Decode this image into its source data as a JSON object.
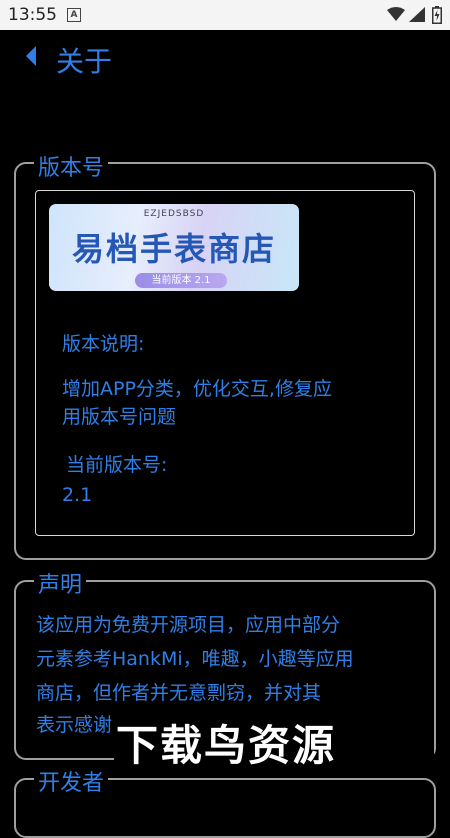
{
  "status_bar": {
    "time": "13:55",
    "notification_letter": "A",
    "icons": [
      "wifi-icon",
      "signal-icon",
      "battery-icon"
    ]
  },
  "header": {
    "back_icon": "chevron-left-icon",
    "title": "关于"
  },
  "version_section": {
    "legend": "版本号",
    "banner": {
      "subtitle": "EZJEDSBSD",
      "title": "易档手表商店",
      "pill": "当前版本 2.1"
    },
    "desc_label": "版本说明:",
    "desc_line1": "增加APP分类，优化交互,修复应",
    "desc_line2": "用版本号问题",
    "current_label": "当前版本号:",
    "current_value": "2.1"
  },
  "statement_section": {
    "legend": "声明",
    "line1": "该应用为免费开源项目，应用中部分",
    "line2": "元素参考HankMi，唯趣，小趣等应用",
    "line3": "商店，但作者并无意剽窃，并对其",
    "line4": "表示感谢"
  },
  "developer_section": {
    "legend": "开发者"
  },
  "watermark": "下载鸟资源",
  "colors": {
    "accent": "#2f7fe6",
    "background": "#000000",
    "border": "#a0a0a0"
  }
}
